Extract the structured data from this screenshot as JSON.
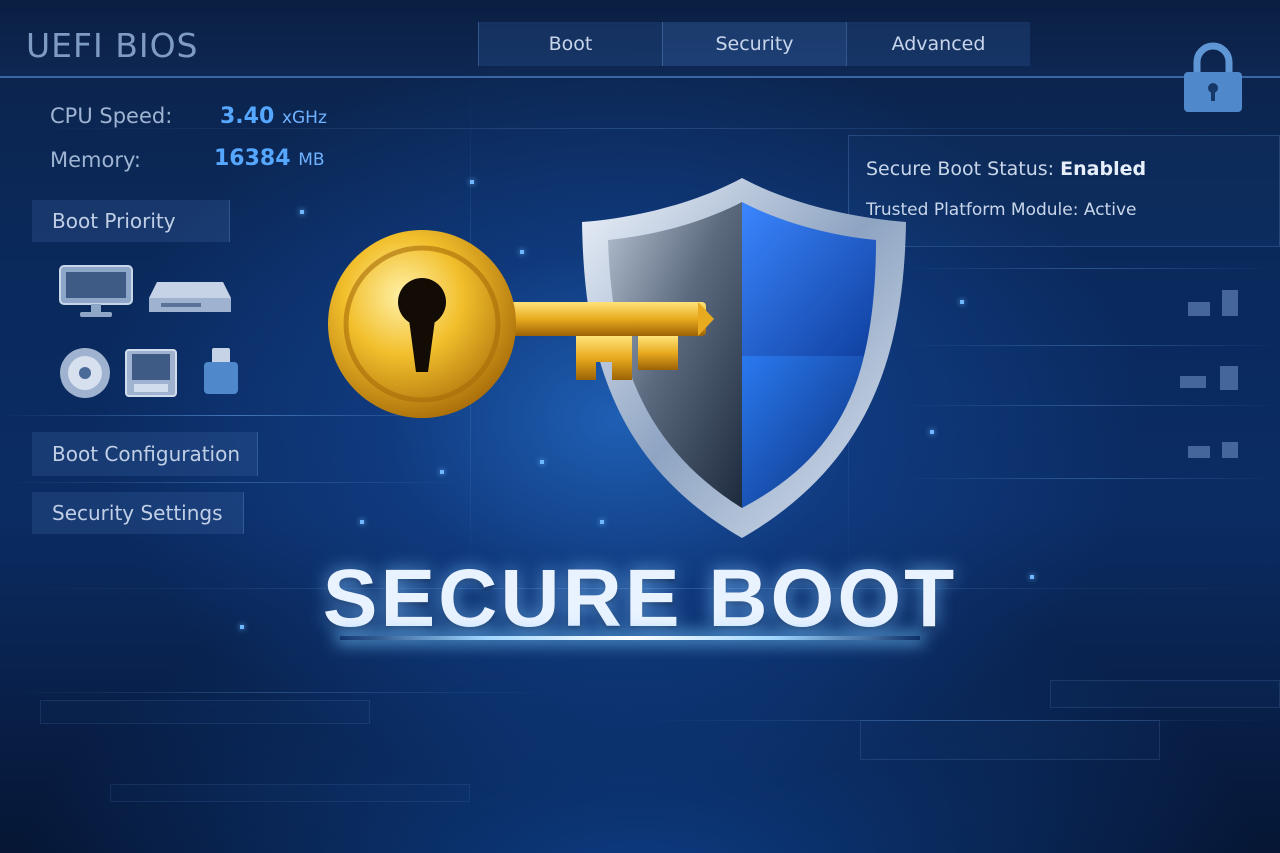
{
  "header": {
    "title": "UEFI BIOS",
    "tabs": [
      {
        "label": "Boot"
      },
      {
        "label": "Security"
      },
      {
        "label": "Advanced"
      }
    ]
  },
  "system_info": {
    "cpu_label": "CPU  Speed:",
    "cpu_value": "3.40",
    "cpu_unit": "xGHz",
    "memory_label": "Memory:",
    "memory_value": "16384",
    "memory_unit": "MB"
  },
  "sidebar": {
    "boot_priority": "Boot Priority",
    "boot_configuration": "Boot Configuration",
    "security_settings": "Security Settings",
    "boot_devices": [
      "monitor-icon",
      "drive-icon",
      "disc-icon",
      "floppy-icon",
      "usb-icon"
    ]
  },
  "status": {
    "secure_boot_label": "Secure Boot Status:",
    "secure_boot_value": "Enabled",
    "tpm_label": "Trusted Platform Module:",
    "tpm_value": "Active"
  },
  "hero": {
    "title": "SECURE BOOT",
    "icons": [
      "key-icon",
      "shield-icon",
      "lock-icon"
    ]
  },
  "colors": {
    "background": "#0b2c63",
    "accent": "#56a7ff",
    "key_gold": "#f0b92a",
    "shield_blue": "#1f63d6"
  }
}
